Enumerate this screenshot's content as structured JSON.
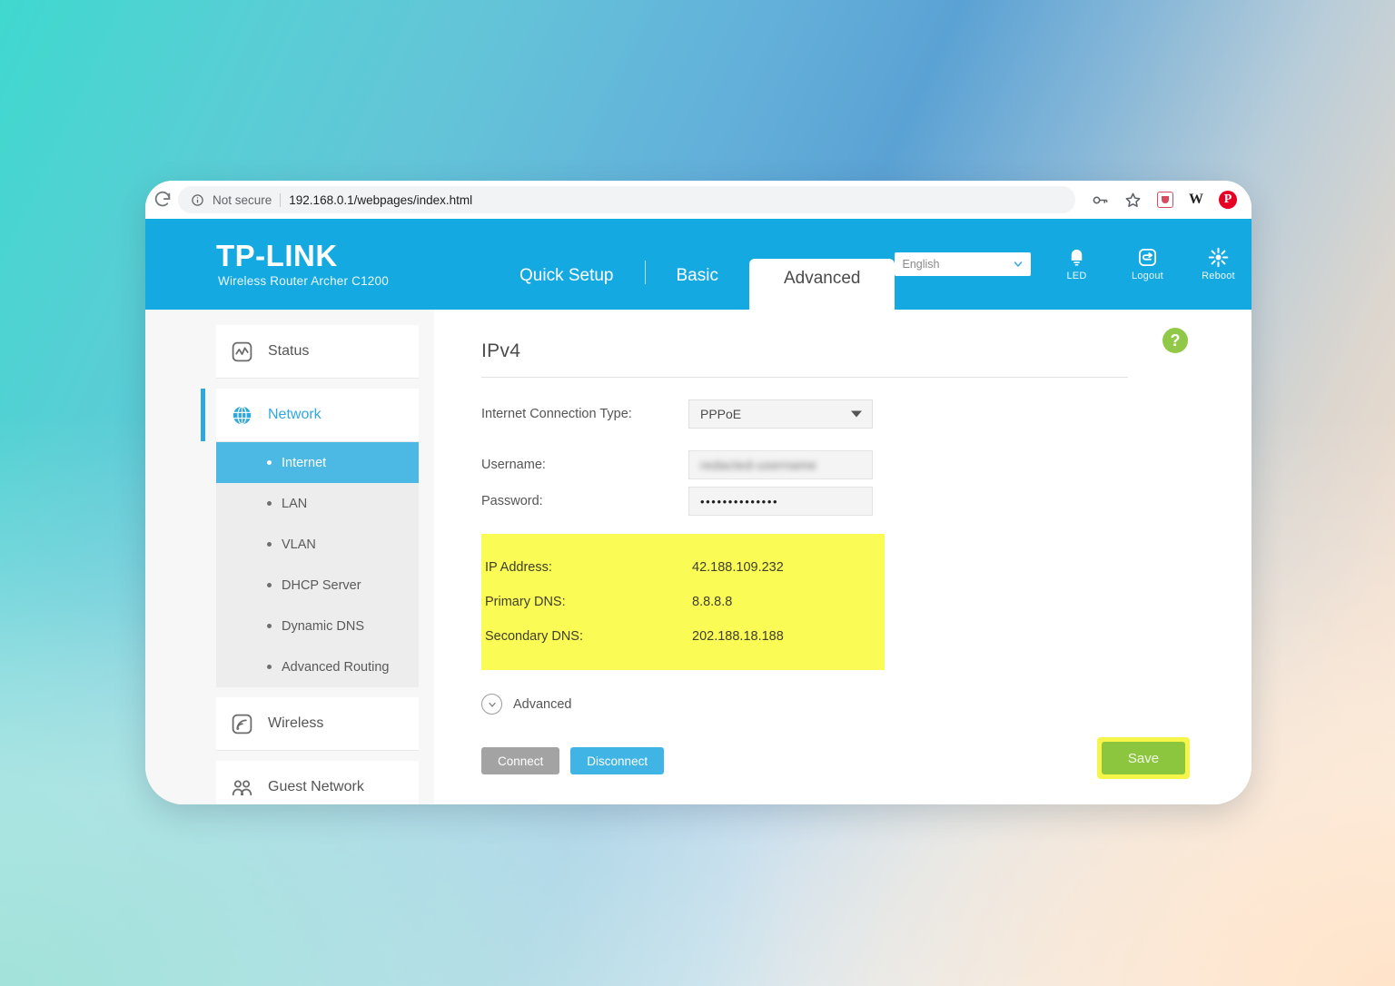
{
  "browser": {
    "reload_icon": "reload-icon",
    "security_icon": "info-circle-icon",
    "security_label": "Not secure",
    "url": "192.168.0.1/webpages/index.html",
    "actions": [
      {
        "name": "password-key-icon",
        "label": ""
      },
      {
        "name": "bookmark-star-icon",
        "label": ""
      },
      {
        "name": "extension-pocket-icon",
        "label": ""
      },
      {
        "name": "extension-wikipedia-icon",
        "label": "W"
      },
      {
        "name": "extension-pinterest-icon",
        "label": "P"
      }
    ]
  },
  "header": {
    "logo": "TP-LINK",
    "subtitle": "Wireless Router Archer C1200",
    "tabs": [
      {
        "label": "Quick Setup",
        "active": false
      },
      {
        "label": "Basic",
        "active": false
      },
      {
        "label": "Advanced",
        "active": true
      }
    ],
    "language": "English",
    "tools": [
      {
        "label": "LED",
        "icon": "led-bulb-icon"
      },
      {
        "label": "Logout",
        "icon": "logout-icon"
      },
      {
        "label": "Reboot",
        "icon": "reboot-icon"
      }
    ]
  },
  "sidebar": {
    "items": [
      {
        "label": "Status",
        "icon": "status-chart-icon",
        "active": false
      },
      {
        "label": "Network",
        "icon": "network-globe-icon",
        "active": true
      },
      {
        "label": "Wireless",
        "icon": "wireless-signal-icon",
        "active": false
      },
      {
        "label": "Guest Network",
        "icon": "guest-network-people-icon",
        "active": false
      }
    ],
    "network_subitems": [
      {
        "label": "Internet",
        "selected": true
      },
      {
        "label": "LAN",
        "selected": false
      },
      {
        "label": "VLAN",
        "selected": false
      },
      {
        "label": "DHCP Server",
        "selected": false
      },
      {
        "label": "Dynamic DNS",
        "selected": false
      },
      {
        "label": "Advanced Routing",
        "selected": false
      }
    ]
  },
  "content": {
    "panel_title": "IPv4",
    "help_label": "?",
    "connection_type_label": "Internet Connection Type:",
    "connection_type_value": "PPPoE",
    "username_label": "Username:",
    "username_value": "redacted-username",
    "password_label": "Password:",
    "password_value": "••••••••••••••",
    "status_rows": [
      {
        "label": "IP Address:",
        "value": "42.188.109.232"
      },
      {
        "label": "Primary DNS:",
        "value": "8.8.8.8"
      },
      {
        "label": "Secondary DNS:",
        "value": "202.188.18.188"
      }
    ],
    "advanced_toggle_label": "Advanced",
    "connect_label": "Connect",
    "disconnect_label": "Disconnect",
    "save_label": "Save"
  },
  "colors": {
    "brand_blue": "#15a9e1",
    "accent_blue": "#3fb4e5",
    "selected_blue": "#4cb8e4",
    "save_green": "#8cc63e",
    "highlight_yellow": "#fbfb56",
    "disabled_gray": "#a3a3a3"
  }
}
